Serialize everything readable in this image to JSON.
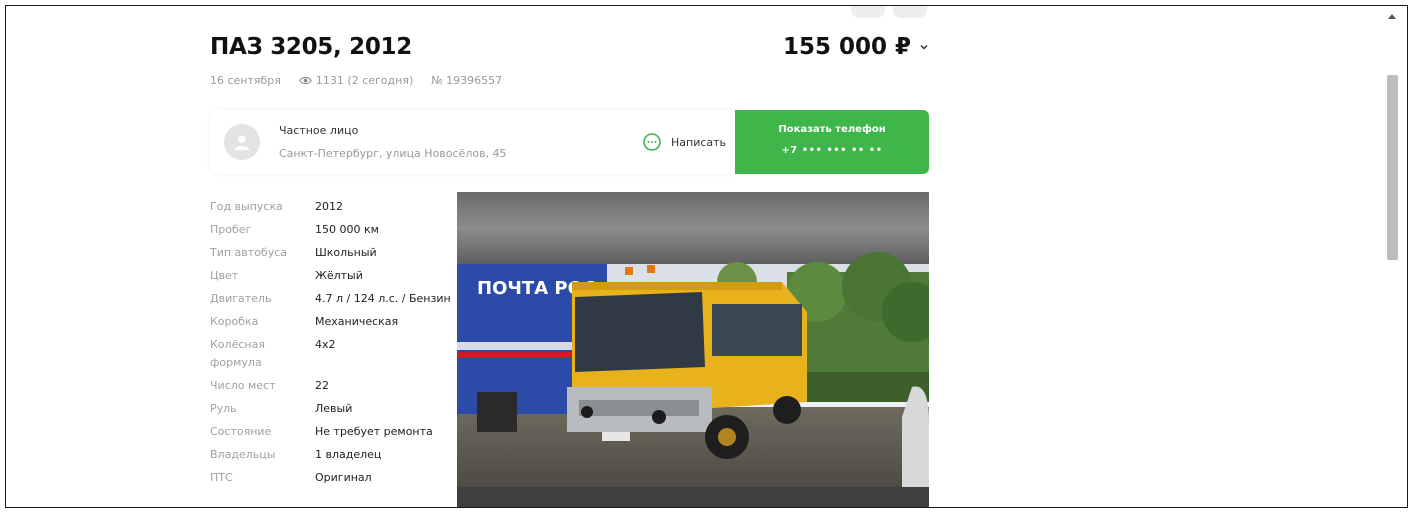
{
  "listing": {
    "title": "ПАЗ 3205, 2012",
    "date": "16 сентября",
    "views": "1131 (2 сегодня)",
    "number": "№ 19396557",
    "price": "155 000 ₽"
  },
  "seller": {
    "type": "Частное лицо",
    "location": "Санкт-Петербург, улица Новосёлов, 45",
    "write_label": "Написать",
    "phone_label": "Показать телефон",
    "phone_masked": "+7 ••• ••• •• ••"
  },
  "specs": [
    {
      "label": "Год выпуска",
      "value": "2012"
    },
    {
      "label": "Пробег",
      "value": "150 000 км"
    },
    {
      "label": "Тип автобуса",
      "value": "Школьный"
    },
    {
      "label": "Цвет",
      "value": "Жёлтый"
    },
    {
      "label": "Двигатель",
      "value": "4.7 л / 124 л.с. / Бензин"
    },
    {
      "label": "Коробка",
      "value": "Механическая"
    },
    {
      "label": "Колёсная формула",
      "value": "4x2"
    },
    {
      "label": "Число мест",
      "value": "22"
    },
    {
      "label": "Руль",
      "value": "Левый"
    },
    {
      "label": "Состояние",
      "value": "Не требует ремонта"
    },
    {
      "label": "Владельцы",
      "value": "1 владелец"
    },
    {
      "label": "ПТС",
      "value": "Оригинал"
    }
  ],
  "photo": {
    "truck_text": "ПОЧТА РОС"
  },
  "colors": {
    "accent_green": "#3fb64a",
    "bus_yellow": "#e8b21c"
  },
  "icons": {
    "views": "eye-icon",
    "write": "chat-bubble-icon",
    "price": "chevron-down-icon",
    "avatar": "user-avatar-icon"
  }
}
